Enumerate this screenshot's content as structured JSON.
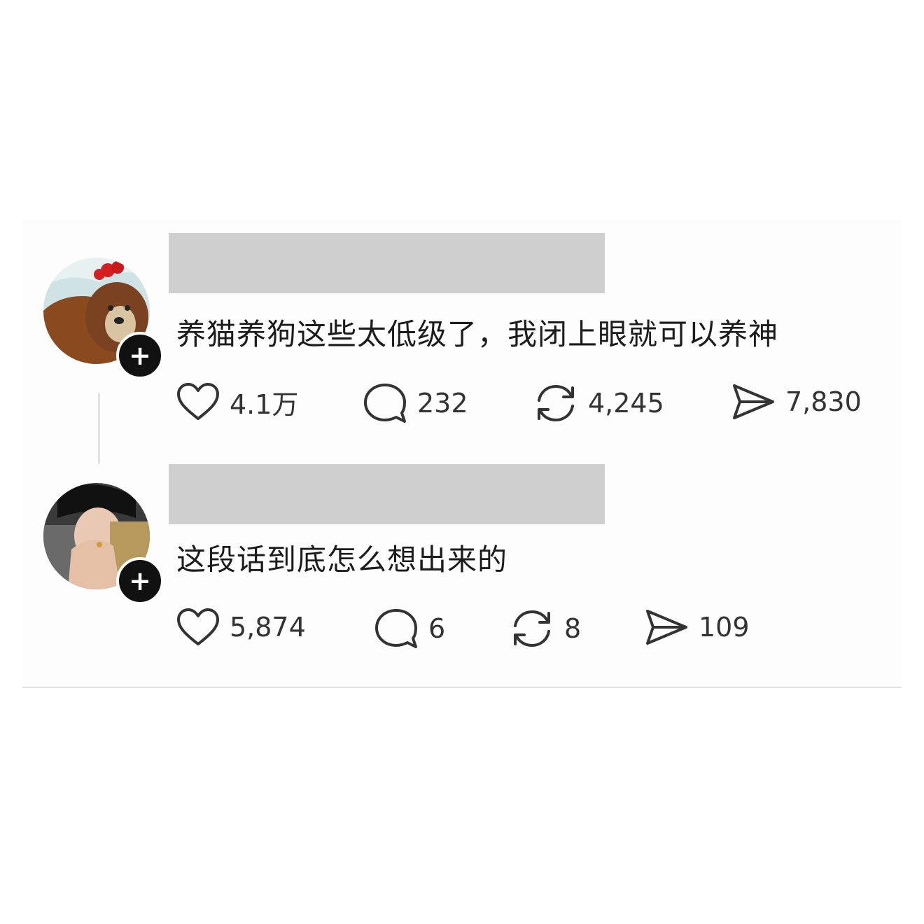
{
  "posts": [
    {
      "name": "",
      "text": "养猫养狗这些太低级了，我闭上眼就可以养神",
      "follow_label": "+",
      "likes": "4.1万",
      "comments": "232",
      "reposts": "4,245",
      "shares": "7,830"
    },
    {
      "name": "",
      "text": "这段话到底怎么想出来的",
      "follow_label": "+",
      "likes": "5,874",
      "comments": "6",
      "reposts": "8",
      "shares": "109"
    }
  ],
  "icons": {
    "like": "heart-icon",
    "comment": "comment-bubble-icon",
    "repost": "repost-icon",
    "share": "send-icon"
  },
  "colors": {
    "background": "#ffffff",
    "card": "#fdfdfd",
    "name_redaction": "#cfcfcf",
    "follow_button": "#111111",
    "text": "#1c1c1c"
  }
}
